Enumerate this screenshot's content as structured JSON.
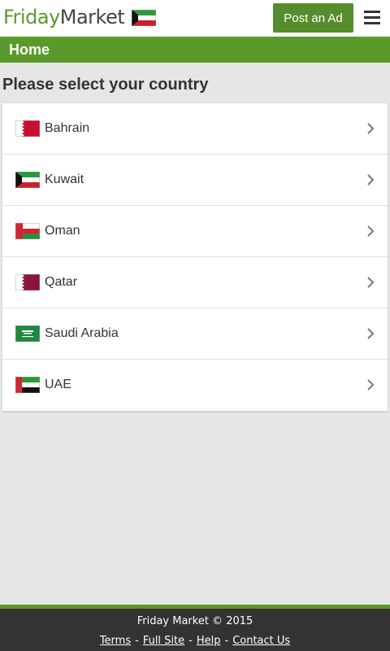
{
  "header": {
    "logo_word1": "Friday",
    "logo_word2": "Market",
    "flag_icon": "kuwait-flag-icon",
    "post_button": "Post an Ad",
    "menu_icon": "hamburger-menu-icon"
  },
  "nav": {
    "breadcrumb": "Home"
  },
  "main": {
    "title": "Please select your country",
    "countries": [
      {
        "label": "Bahrain",
        "flag": "bahrain-flag-icon"
      },
      {
        "label": "Kuwait",
        "flag": "kuwait-flag-icon"
      },
      {
        "label": "Oman",
        "flag": "oman-flag-icon"
      },
      {
        "label": "Qatar",
        "flag": "qatar-flag-icon"
      },
      {
        "label": "Saudi Arabia",
        "flag": "saudi-arabia-flag-icon"
      },
      {
        "label": "UAE",
        "flag": "uae-flag-icon"
      }
    ]
  },
  "footer": {
    "copyright": "Friday Market © 2015",
    "links": [
      "Terms",
      "Full Site",
      "Help",
      "Contact Us"
    ],
    "separator": "-"
  },
  "colors": {
    "brand_green": "#5a9a2a",
    "button_green": "#568d2c",
    "footer_bg": "#333333",
    "page_bg": "#e6e6e6"
  }
}
